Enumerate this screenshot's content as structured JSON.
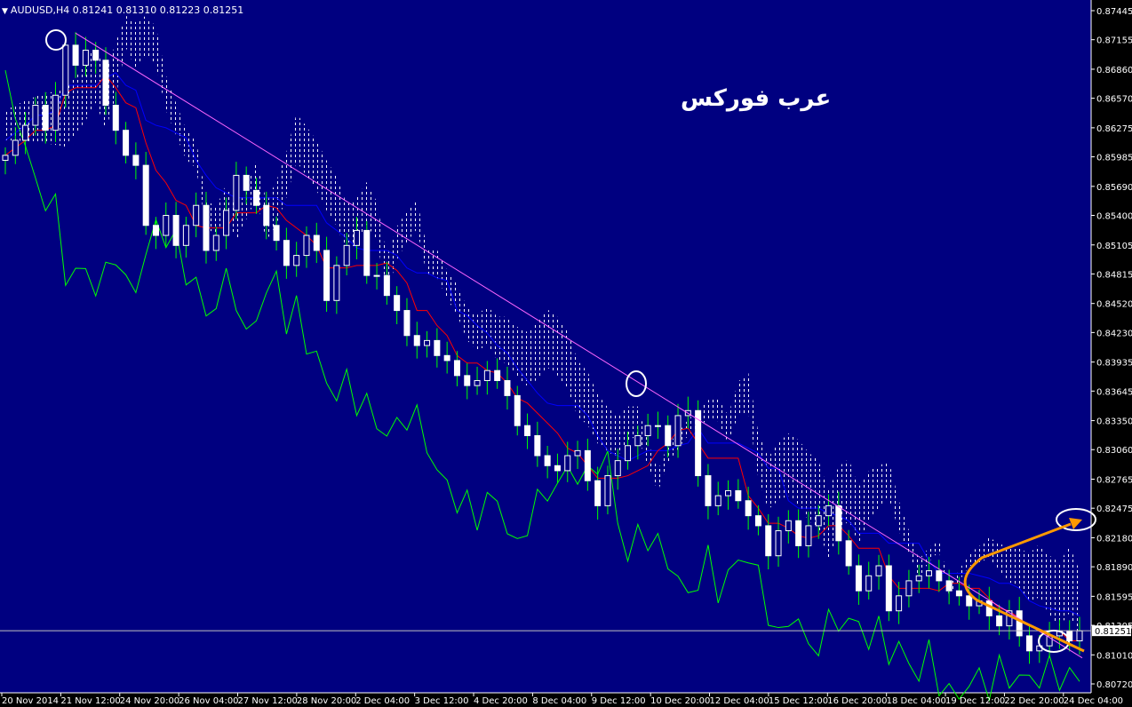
{
  "header": {
    "symbol": "AUDUSD,H4",
    "ohlc": "0.81241 0.81310 0.81223 0.81251"
  },
  "watermark": "عرب فوركس",
  "colors": {
    "background": "#000080",
    "candle_up": "#ffffff",
    "candle_down": "#ffffff",
    "wick": "#00ff00",
    "kijun": "#ff0000",
    "tenkan": "#0000ff",
    "chikou": "#00ff00",
    "kumo": "#ffffff",
    "trendline": "#ff66ff",
    "arrow": "#ff9900",
    "circle": "#ffffff"
  },
  "chart_data": {
    "type": "candlestick",
    "title": "AUDUSD,H4",
    "ylim": [
      0.8072,
      0.87445
    ],
    "y_ticks": [
      "0.87445",
      "0.87155",
      "0.86860",
      "0.86570",
      "0.86275",
      "0.85985",
      "0.85690",
      "0.85400",
      "0.85105",
      "0.84815",
      "0.84520",
      "0.84230",
      "0.83935",
      "0.83645",
      "0.83350",
      "0.83060",
      "0.82765",
      "0.82475",
      "0.82180",
      "0.81890",
      "0.81595",
      "0.81305",
      "0.81010",
      "0.80720"
    ],
    "x_ticks": [
      "20 Nov 2014",
      "21 Nov 12:00",
      "24 Nov 20:00",
      "26 Nov 04:00",
      "27 Nov 12:00",
      "28 Nov 20:00",
      "2 Dec 04:00",
      "3 Dec 12:00",
      "4 Dec 20:00",
      "8 Dec 04:00",
      "9 Dec 12:00",
      "10 Dec 20:00",
      "12 Dec 04:00",
      "15 Dec 12:00",
      "16 Dec 20:00",
      "18 Dec 04:00",
      "19 Dec 12:00",
      "22 Dec 20:00",
      "24 Dec 04:00"
    ],
    "current_price": "0.81251",
    "close_series": [
      0.86,
      0.8615,
      0.863,
      0.865,
      0.8625,
      0.866,
      0.871,
      0.869,
      0.8705,
      0.8695,
      0.865,
      0.8625,
      0.86,
      0.859,
      0.853,
      0.852,
      0.854,
      0.851,
      0.853,
      0.855,
      0.8505,
      0.852,
      0.8545,
      0.858,
      0.8565,
      0.855,
      0.853,
      0.8515,
      0.849,
      0.85,
      0.852,
      0.8505,
      0.8455,
      0.849,
      0.851,
      0.8525,
      0.848,
      0.848,
      0.846,
      0.8445,
      0.842,
      0.841,
      0.8415,
      0.84,
      0.8395,
      0.838,
      0.837,
      0.8375,
      0.8385,
      0.8375,
      0.836,
      0.833,
      0.832,
      0.83,
      0.829,
      0.8285,
      0.83,
      0.8305,
      0.8275,
      0.825,
      0.828,
      0.8295,
      0.831,
      0.832,
      0.833,
      0.833,
      0.831,
      0.834,
      0.8345,
      0.828,
      0.825,
      0.826,
      0.8265,
      0.8255,
      0.824,
      0.823,
      0.82,
      0.8225,
      0.8235,
      0.821,
      0.823,
      0.824,
      0.825,
      0.8215,
      0.819,
      0.8165,
      0.818,
      0.819,
      0.8145,
      0.816,
      0.8175,
      0.818,
      0.8185,
      0.8175,
      0.8165,
      0.816,
      0.815,
      0.8155,
      0.814,
      0.813,
      0.8145,
      0.812,
      0.8105,
      0.811,
      0.812,
      0.8125,
      0.8115,
      0.8125
    ],
    "annotations": [
      "trendline from 21 Nov high through 10 Dec high",
      "arrow pointing up to kumo bottom near 0.8240"
    ]
  }
}
